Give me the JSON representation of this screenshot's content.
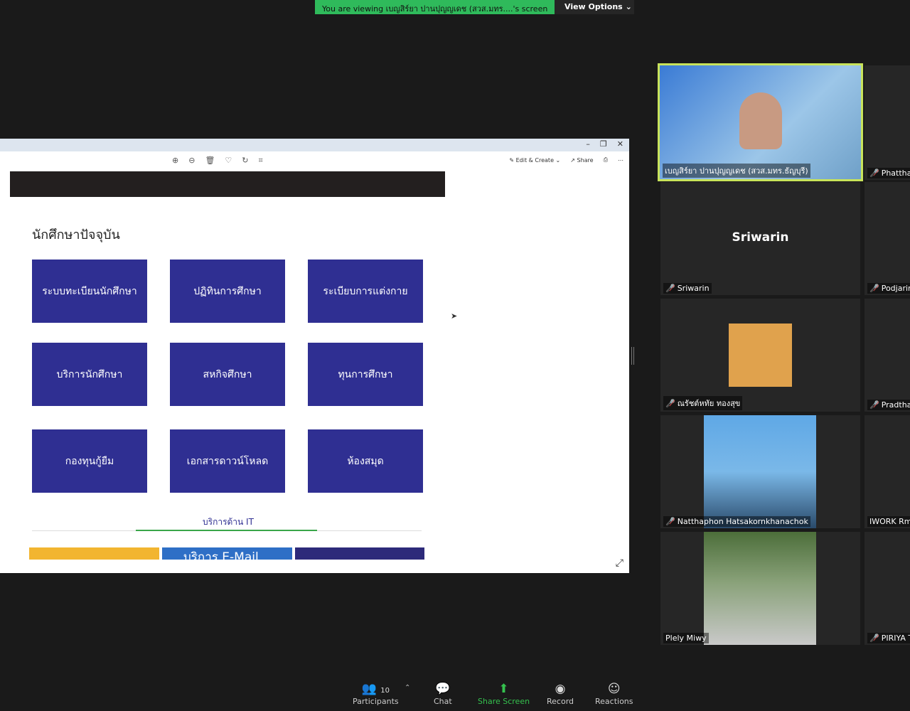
{
  "banner": {
    "viewing": "You are viewing เบญสิร์ยา ปานปุญญเดช (สวส.มทร....'s screen",
    "view_options": "View Options"
  },
  "viewer": {
    "toolbar": {
      "edit_create": "Edit & Create",
      "share": "Share"
    },
    "section_title": "นักศึกษาปัจจุบัน",
    "tiles": [
      "ระบบทะเบียนนักศึกษา",
      "ปฏิทินการศึกษา",
      "ระเบียบการแต่งกาย",
      "บริการนักศึกษา",
      "สหกิจศึกษา",
      "ทุนการศึกษา",
      "กองทุนกู้ยืม",
      "เอกสารดาวน์โหลด",
      "ห้องสมุด"
    ],
    "it_title": "บริการด้าน IT",
    "banner_texts": [
      "",
      "บริการ E-Mail",
      ""
    ]
  },
  "participants": [
    {
      "name": "เบญสิร์ยา ปานปุญญเดช (สวส.มทร.ธัญบุรี)"
    },
    {
      "name": "Phatthar"
    },
    {
      "name": "Sriwarin",
      "display": "Sriwarin"
    },
    {
      "name": "Podjarin"
    },
    {
      "name": "ณรัชต์หทัย  ทองสุข"
    },
    {
      "name": "Pradthar"
    },
    {
      "name": "Natthaphon Hatsakornkhanachok"
    },
    {
      "name": "IWORK Rm"
    },
    {
      "name": "Plely Miwy"
    },
    {
      "name": "PIRIYA T"
    }
  ],
  "footer": {
    "participants_label": "Participants",
    "participants_count": "10",
    "chat": "Chat",
    "share_screen": "Share Screen",
    "record": "Record",
    "reactions": "Reactions"
  },
  "colors": {
    "share_green": "#2fba5b",
    "tile_blue": "#2f2f92",
    "active_border": "#c8e35a"
  }
}
